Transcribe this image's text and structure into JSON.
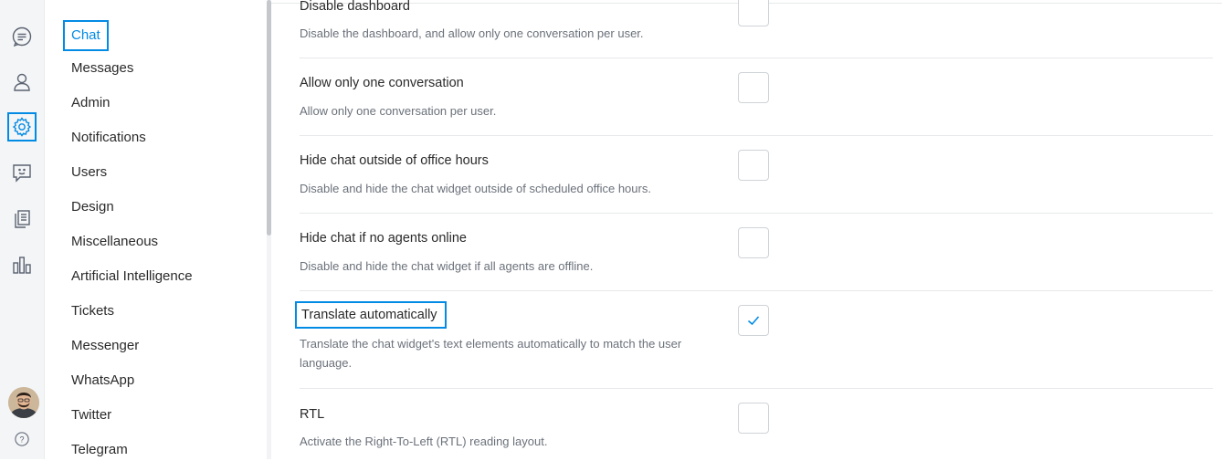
{
  "rail": {
    "icons": [
      "conversations-icon",
      "users-icon",
      "settings-icon",
      "chatbot-icon",
      "articles-icon",
      "reports-icon"
    ],
    "active": "settings-icon",
    "help_glyph": "?"
  },
  "nav": {
    "items": [
      {
        "label": "Chat",
        "active": true
      },
      {
        "label": "Messages"
      },
      {
        "label": "Admin"
      },
      {
        "label": "Notifications"
      },
      {
        "label": "Users"
      },
      {
        "label": "Design"
      },
      {
        "label": "Miscellaneous"
      },
      {
        "label": "Artificial Intelligence"
      },
      {
        "label": "Tickets"
      },
      {
        "label": "Messenger"
      },
      {
        "label": "WhatsApp"
      },
      {
        "label": "Twitter"
      },
      {
        "label": "Telegram"
      }
    ]
  },
  "settings": [
    {
      "title": "Disable dashboard",
      "description": "Disable the dashboard, and allow only one conversation per user.",
      "checked": false
    },
    {
      "title": "Allow only one conversation",
      "description": "Allow only one conversation per user.",
      "checked": false
    },
    {
      "title": "Hide chat outside of office hours",
      "description": "Disable and hide the chat widget outside of scheduled office hours.",
      "checked": false
    },
    {
      "title": "Hide chat if no agents online",
      "description": "Disable and hide the chat widget if all agents are offline.",
      "checked": false
    },
    {
      "title": "Translate automatically",
      "description": "Translate the chat widget's text elements automatically to match the user language.",
      "checked": true
    },
    {
      "title": "RTL",
      "description": "Activate the Right-To-Left (RTL) reading layout.",
      "checked": false
    }
  ],
  "colors": {
    "accent": "#028be5",
    "text": "#2a2a2a",
    "muted": "#6b717a"
  }
}
